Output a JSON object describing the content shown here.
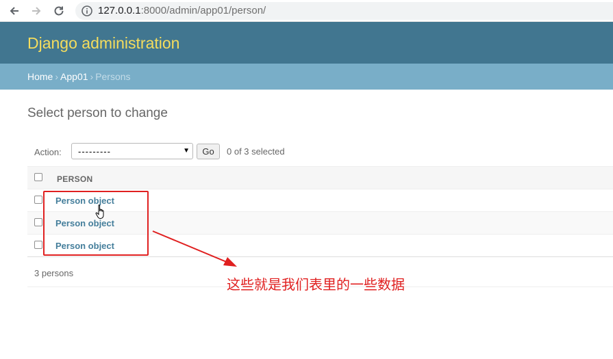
{
  "browser": {
    "url_host": "127.0.0.1",
    "url_path": ":8000/admin/app01/person/"
  },
  "header": {
    "site_title": "Django administration"
  },
  "breadcrumbs": {
    "home": "Home",
    "app": "App01",
    "current": "Persons",
    "separator": "›"
  },
  "content": {
    "title": "Select person to change"
  },
  "actions": {
    "label": "Action:",
    "selected_value": "---------",
    "go_label": "Go",
    "selection_count": "0 of 3 selected"
  },
  "table": {
    "column_header": "PERSON",
    "rows": [
      {
        "label": "Person object"
      },
      {
        "label": "Person object"
      },
      {
        "label": "Person object"
      }
    ]
  },
  "paginator": {
    "count_text": "3 persons"
  },
  "annotation": {
    "text": "这些就是我们表里的一些数据",
    "color": "#e02020"
  },
  "colors": {
    "header_bg": "#417690",
    "title_yellow": "#f5dd5d",
    "breadcrumb_bg": "#79aec8",
    "link_blue": "#447e9b"
  }
}
